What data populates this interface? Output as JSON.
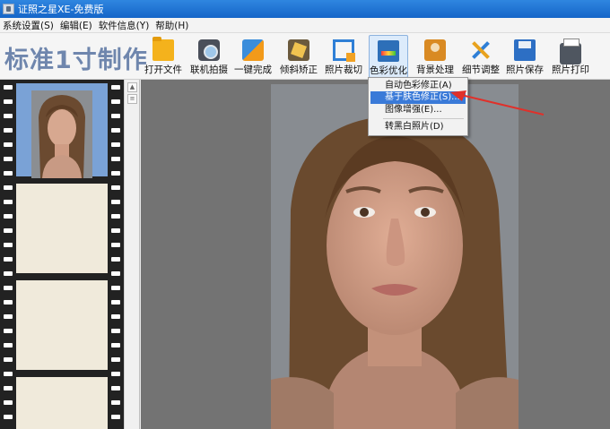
{
  "window": {
    "title": "证照之星XE-免费版"
  },
  "menubar": {
    "items": [
      "系统设置(S)",
      "编辑(E)",
      "软件信息(Y)",
      "帮助(H)"
    ]
  },
  "toolbar": {
    "brand": "标准1寸制作",
    "tools": [
      {
        "label": "打开文件",
        "icon": "folder-icon"
      },
      {
        "label": "联机拍摄",
        "icon": "camera-icon"
      },
      {
        "label": "一键完成",
        "icon": "magic-wand-icon"
      },
      {
        "label": "倾斜矫正",
        "icon": "rotate-icon"
      },
      {
        "label": "照片裁切",
        "icon": "crop-icon"
      },
      {
        "label": "色彩优化",
        "icon": "color-palette-icon"
      },
      {
        "label": "背景处理",
        "icon": "background-icon"
      },
      {
        "label": "细节调整",
        "icon": "tools-icon"
      },
      {
        "label": "照片保存",
        "icon": "save-icon"
      },
      {
        "label": "照片打印",
        "icon": "printer-icon"
      }
    ],
    "active_tool": "色彩优化"
  },
  "color_menu": {
    "items": [
      "自动色彩修正(A)",
      "基于肤色修正(S)...",
      "图像增强(E)...",
      "转黑白照片(D)"
    ],
    "highlighted": "基于肤色修正(S)..."
  },
  "colors": {
    "title_bar": "#1565c8",
    "selection": "#3a7ad8",
    "brand_text": "#6f86ad",
    "arrow": "#e0302a"
  }
}
